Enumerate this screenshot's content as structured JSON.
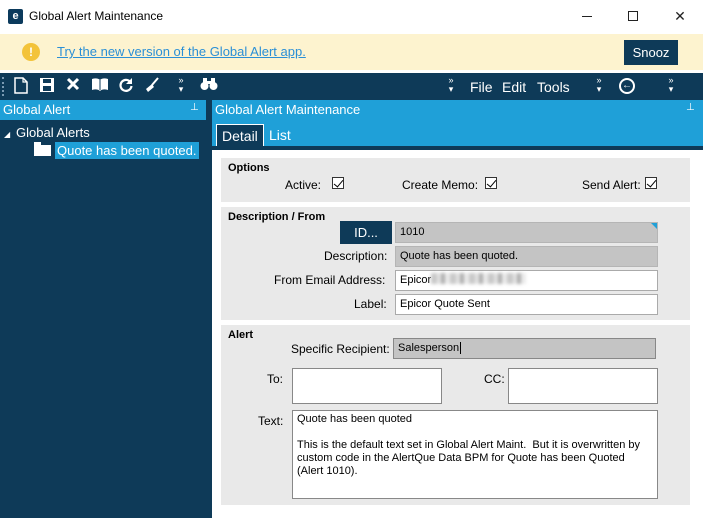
{
  "window": {
    "title": "Global Alert Maintenance",
    "app_icon_letter": "e"
  },
  "banner": {
    "icon": "warning-icon",
    "link_text": "Try the new version of the Global Alert app.",
    "snooze_label": "Snooz"
  },
  "toolbar": {
    "menus": [
      "File",
      "Edit",
      "Tools"
    ]
  },
  "left_panel": {
    "header": "Global Alert",
    "tree_root": "Global Alerts",
    "tree_child": "Quote has been quoted."
  },
  "right_panel": {
    "header": "Global Alert Maintenance",
    "tabs": [
      "Detail",
      "List"
    ]
  },
  "options": {
    "title": "Options",
    "active_label": "Active:",
    "active_checked": true,
    "create_memo_label": "Create Memo:",
    "create_memo_checked": true,
    "send_alert_label": "Send Alert:",
    "send_alert_checked": true
  },
  "description_group": {
    "title": "Description / From",
    "id_button": "ID...",
    "id_value": "1010",
    "description_label": "Description:",
    "description_value": "Quote has been quoted.",
    "from_email_label": "From Email Address:",
    "from_email_value": "Epicor",
    "label_label": "Label:",
    "label_value": "Epicor Quote Sent"
  },
  "alert_group": {
    "title": "Alert",
    "specific_recipient_label": "Specific Recipient:",
    "specific_recipient_value": "Salesperson",
    "to_label": "To:",
    "to_value": "",
    "cc_label": "CC:",
    "cc_value": "",
    "text_label": "Text:",
    "text_value": "Quote has been quoted\n\nThis is the default text set in Global Alert Maint.  But it is overwritten by custom code in the AlertQue Data BPM for Quote has been Quoted (Alert 1010)."
  },
  "colors": {
    "navy": "#0e3a58",
    "accent_blue": "#1fa0d8",
    "banner_bg": "#fdf3cf",
    "group_bg": "#e9e9e9"
  }
}
